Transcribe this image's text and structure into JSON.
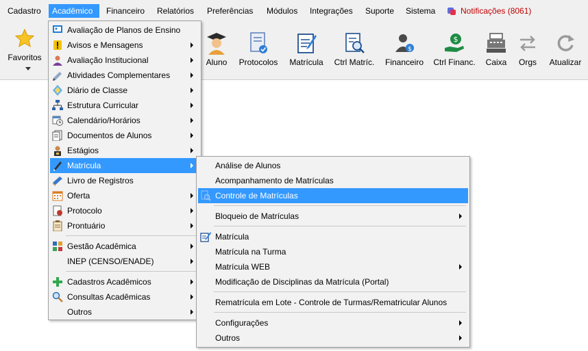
{
  "menubar": {
    "items": [
      "Cadastro",
      "Acadêmico",
      "Financeiro",
      "Relatórios",
      "Preferências",
      "Módulos",
      "Integrações",
      "Suporte",
      "Sistema"
    ],
    "notifications": "Notificações (8061)"
  },
  "toolbar": {
    "favorites": "Favoritos",
    "buttons": [
      "Aluno",
      "Protocolos",
      "Matrícula",
      "Ctrl Matríc.",
      "Financeiro",
      "Ctrl Financ.",
      "Caixa",
      "Orgs",
      "Atualizar"
    ]
  },
  "academic_menu": {
    "items": [
      {
        "label": "Avaliação de Planos de Ensino",
        "icon": "presentation-board-icon"
      },
      {
        "label": "Avisos e Mensagens",
        "icon": "warning-icon"
      },
      {
        "label": "Avaliação Institucional",
        "icon": "person-evaluation-icon"
      },
      {
        "label": "Atividades Complementares",
        "icon": "pencil-eraser-icon"
      },
      {
        "label": "Diário de Classe",
        "icon": "diamond-book-icon"
      },
      {
        "label": "Estrutura Curricular",
        "icon": "hierarchy-icon"
      },
      {
        "label": "Calendário/Horários",
        "icon": "calendar-clock-icon"
      },
      {
        "label": "Documentos de Alunos",
        "icon": "documents-icon"
      },
      {
        "label": "Estágios",
        "icon": "intern-icon"
      },
      {
        "label": "Matrícula",
        "icon": "enrollment-pen-icon"
      },
      {
        "label": "Livro de Registros",
        "icon": "book-icon"
      },
      {
        "label": "Oferta",
        "icon": "calendar-grid-icon"
      },
      {
        "label": "Protocolo",
        "icon": "protocol-icon"
      },
      {
        "label": "Prontuário",
        "icon": "clipboard-icon"
      },
      {
        "label": "Gestão Acadêmica",
        "icon": "management-icon"
      },
      {
        "label": "INEP (CENSO/ENADE)",
        "icon": ""
      },
      {
        "label": "Cadastros Acadêmicos",
        "icon": "green-plus-icon"
      },
      {
        "label": "Consultas Acadêmicas",
        "icon": "magnifier-icon"
      },
      {
        "label": "Outros",
        "icon": ""
      }
    ]
  },
  "matricula_menu": {
    "items": [
      "Análise de Alunos",
      "Acompanhamento de Matrículas",
      "Controle de Matrículas",
      "Bloqueio de Matrículas",
      "Matrícula",
      "Matrícula na Turma",
      "Matrícula WEB",
      "Modificação de Disciplinas da Matrícula (Portal)",
      "Rematrícula em Lote - Controle de Turmas/Rematricular Alunos",
      "Configurações",
      "Outros"
    ]
  },
  "colors": {
    "highlight": "#3399ff",
    "notification": "#c00000",
    "menu_bg": "#f2f2f2"
  }
}
